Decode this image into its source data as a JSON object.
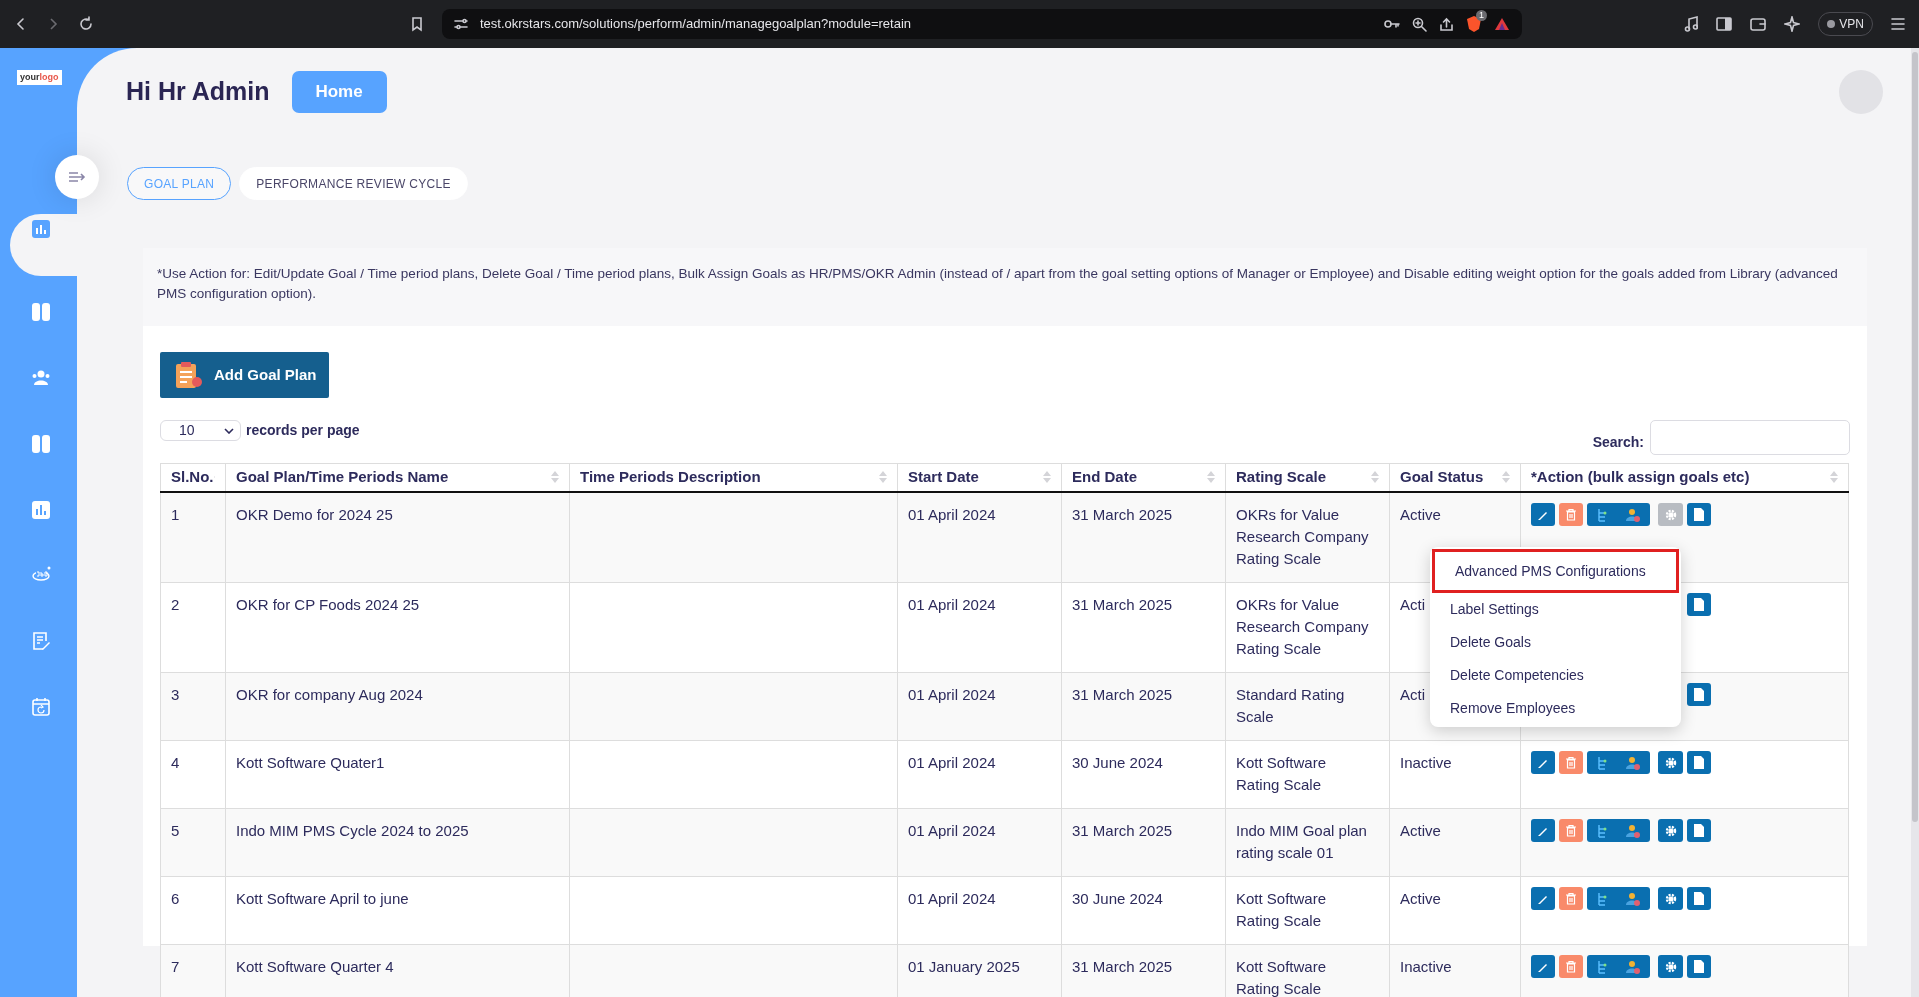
{
  "browser": {
    "url": "test.okrstars.com/solutions/perform/admin/managegoalplan?module=retain",
    "vpn_label": "VPN",
    "shield_badge": "1"
  },
  "logo": {
    "first": "your",
    "second": "logo"
  },
  "sidebar": {
    "items": [
      {
        "selected": true
      },
      {
        "selected": false
      },
      {
        "selected": false
      },
      {
        "selected": false
      },
      {
        "selected": false
      },
      {
        "selected": false
      },
      {
        "selected": false
      },
      {
        "selected": false
      }
    ]
  },
  "header": {
    "greeting": "Hi Hr Admin",
    "home_button": "Home"
  },
  "tabs": [
    {
      "label": "GOAL PLAN",
      "selected": true
    },
    {
      "label": "PERFORMANCE REVIEW CYCLE",
      "selected": false
    }
  ],
  "notice": "*Use Action for: Edit/Update Goal / Time period plans, Delete Goal / Time period plans, Bulk Assign Goals as HR/PMS/OKR Admin (instead of / apart from the goal setting options of Manager or Employee) and Disable editing weight option for the goals added from Library (advanced PMS configuration option).",
  "add_button": "Add Goal Plan",
  "page_size": {
    "value": "10",
    "label": "records per page"
  },
  "search": {
    "label": "Search:"
  },
  "table": {
    "columns": [
      "Sl.No.",
      "Goal Plan/Time Periods Name",
      "Time Periods Description",
      "Start Date",
      "End Date",
      "Rating Scale",
      "Goal Status",
      "*Action (bulk assign goals etc)"
    ],
    "rows": [
      {
        "no": "1",
        "name": "OKR Demo for 2024 25",
        "start": "01 April 2024",
        "end": "31 March 2025",
        "scale": "OKRs for Value Research Company Rating Scale",
        "status": "Active",
        "actions": [
          {
            "kind": "edit"
          },
          {
            "kind": "delete"
          },
          {
            "kind": "assign"
          },
          {
            "kind": "settings",
            "open": true
          },
          {
            "kind": "document"
          }
        ]
      },
      {
        "no": "2",
        "name": "OKR for CP Foods 2024 25",
        "start": "01 April 2024",
        "end": "31 March 2025",
        "scale": "OKRs for Value Research Company Rating Scale",
        "status": "Acti",
        "actions": [
          {
            "kind": "document"
          }
        ]
      },
      {
        "no": "3",
        "name": "OKR for company Aug 2024",
        "start": "01 April 2024",
        "end": "31 March 2025",
        "scale": "Standard Rating Scale",
        "status": "Acti",
        "actions": [
          {
            "kind": "document"
          }
        ]
      },
      {
        "no": "4",
        "name": "Kott Software Quater1",
        "start": "01 April 2024",
        "end": "30 June 2024",
        "scale": "Kott Software Rating Scale",
        "status": "Inactive",
        "actions": [
          {
            "kind": "edit"
          },
          {
            "kind": "delete"
          },
          {
            "kind": "assign"
          },
          {
            "kind": "settings",
            "open": false
          },
          {
            "kind": "document"
          }
        ]
      },
      {
        "no": "5",
        "name": "Indo MIM PMS Cycle 2024 to 2025",
        "start": "01 April 2024",
        "end": "31 March 2025",
        "scale": "Indo MIM Goal plan rating scale 01",
        "status": "Active",
        "actions": [
          {
            "kind": "edit"
          },
          {
            "kind": "delete"
          },
          {
            "kind": "assign"
          },
          {
            "kind": "settings",
            "open": false
          },
          {
            "kind": "document"
          }
        ]
      },
      {
        "no": "6",
        "name": "Kott Software April to june",
        "start": "01 April 2024",
        "end": "30 June 2024",
        "scale": "Kott Software Rating Scale",
        "status": "Active",
        "actions": [
          {
            "kind": "edit"
          },
          {
            "kind": "delete"
          },
          {
            "kind": "assign"
          },
          {
            "kind": "settings",
            "open": false
          },
          {
            "kind": "document"
          }
        ]
      },
      {
        "no": "7",
        "name": "Kott Software Quarter 4",
        "start": "01 January 2025",
        "end": "31 March 2025",
        "scale": "Kott Software Rating Scale",
        "status": "Inactive",
        "actions": [
          {
            "kind": "edit"
          },
          {
            "kind": "delete"
          },
          {
            "kind": "assign"
          },
          {
            "kind": "settings",
            "open": false
          },
          {
            "kind": "document"
          }
        ]
      }
    ]
  },
  "menu": {
    "items": [
      {
        "label": "Advanced PMS Configurations",
        "highlighted": true
      },
      {
        "label": "Label Settings",
        "highlighted": false
      },
      {
        "label": "Delete Goals",
        "highlighted": false
      },
      {
        "label": "Delete Competencies",
        "highlighted": false
      },
      {
        "label": "Remove Employees",
        "highlighted": false
      }
    ]
  }
}
